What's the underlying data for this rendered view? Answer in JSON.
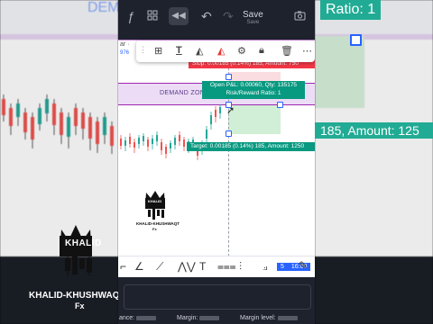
{
  "toolbar": {
    "fx_icon": "ƒ",
    "save_label": "Save",
    "save_sub": "Save",
    "symbol": "ar ·",
    "symbol_price": "976"
  },
  "drawing": {
    "stop_label": "Stop: 0.00185 (0.14%) 185, Amount: 750",
    "zone_label": "DEMAND ZONE",
    "rr_line1": "Open P&L: 0.00060, Qty: 135175",
    "rr_line2": "Risk/Reward Ratio: 1",
    "target_label": "Target: 0.00185 (0.14%) 185, Amount: 1250"
  },
  "logo": {
    "name": "KHALID",
    "caption": "KHALID-KHUSHWAQT",
    "suffix": "Fx"
  },
  "bottom": {
    "time": "16:00",
    "time_prefix": "5"
  },
  "account": {
    "balance_label": "ance:",
    "margin_label": "Margin:",
    "margin_level_label": "Margin level:"
  },
  "background": {
    "demand_text": "DEMAN",
    "ratio_text": "Ratio: 1",
    "amount_text": "185, Amount: 125"
  },
  "colors": {
    "accent": "#2962ff",
    "stop": "#f23645",
    "target": "#089981",
    "zone": "#9c27b0"
  }
}
